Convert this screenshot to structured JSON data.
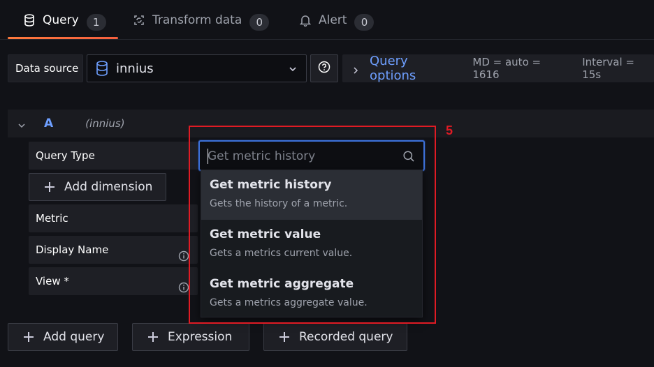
{
  "tabs": [
    {
      "label": "Query",
      "count": "1",
      "icon": "database-icon"
    },
    {
      "label": "Transform data",
      "count": "0",
      "icon": "transform-icon"
    },
    {
      "label": "Alert",
      "count": "0",
      "icon": "bell-icon"
    }
  ],
  "datasource": {
    "label": "Data source",
    "selected": "innius",
    "help_icon": "question-circle-icon"
  },
  "query_options": {
    "title": "Query options",
    "md": "MD = auto = 1616",
    "interval": "Interval = 15s"
  },
  "query_a": {
    "name": "A",
    "source": "(innius)"
  },
  "form": {
    "query_type_label": "Query Type",
    "add_dimension_label": "Add dimension",
    "metric_label": "Metric",
    "display_name_label": "Display Name",
    "view_label": "View *"
  },
  "dropdown": {
    "search_placeholder": "Get metric history",
    "options": [
      {
        "title": "Get metric history",
        "description": "Gets the history of a metric."
      },
      {
        "title": "Get metric value",
        "description": "Gets a metrics current value."
      },
      {
        "title": "Get metric aggregate",
        "description": "Gets a metrics aggregate value."
      }
    ]
  },
  "bottom": {
    "add_query": "Add query",
    "expression": "Expression",
    "recorded_query": "Recorded query"
  },
  "annotation": {
    "number": "5",
    "color": "#e01b24"
  },
  "colors": {
    "accent_blue": "#6e9fff",
    "tab_gradient_start": "#ff7a3d",
    "background": "#111217"
  }
}
